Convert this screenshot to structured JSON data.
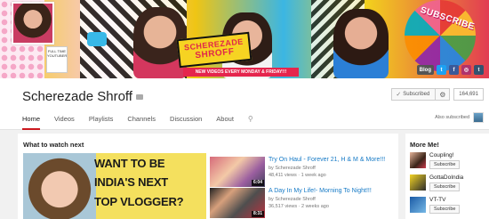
{
  "banner": {
    "logo_line1": "SCHEREZADE",
    "logo_line2": "SHROFF",
    "tagline": "NEW VIDEOS EVERY MONDAY & FRIDAY!!!",
    "subscribe_art": "SUBSCRIBE",
    "phone_card_text": "FULL TIME YOUTUBER",
    "links": [
      {
        "label": "Blog",
        "icon": "blog-icon",
        "color": "#555555"
      },
      {
        "label": "t",
        "icon": "twitter-icon",
        "color": "#1da1f2"
      },
      {
        "label": "f",
        "icon": "facebook-icon",
        "color": "#3b5998"
      },
      {
        "label": "◎",
        "icon": "instagram-icon",
        "color": "#b0326d"
      },
      {
        "label": "t",
        "icon": "tumblr-icon",
        "color": "#34526f"
      }
    ]
  },
  "channel": {
    "title": "Scherezade Shroff",
    "subscribe_label": "Subscribed",
    "subscriber_count": "164,691"
  },
  "tabs": [
    {
      "label": "Home",
      "active": true
    },
    {
      "label": "Videos"
    },
    {
      "label": "Playlists"
    },
    {
      "label": "Channels"
    },
    {
      "label": "Discussion"
    },
    {
      "label": "About"
    }
  ],
  "also_subscribed_label": "Also subscribed",
  "main": {
    "section_title": "What to watch next",
    "feature_text": [
      "WANT TO BE",
      "INDIA'S NEXT",
      "TOP VLOGGER?"
    ],
    "videos": [
      {
        "title": "Try On Haul - Forever 21, H & M & More!!!",
        "by": "by Scherezade Shroff",
        "meta": "48,411 views · 1 week ago",
        "duration": "6:04"
      },
      {
        "title": "A Day In My Life!- Morning To Night!!!",
        "by": "by Scherezade Shroff",
        "meta": "36,517 views · 2 weeks ago",
        "duration": "8:31"
      }
    ]
  },
  "sidebar": {
    "title": "More Me!",
    "items": [
      {
        "name": "Coupling!",
        "button": "Subscribe"
      },
      {
        "name": "GottaDoIndia",
        "button": "Subscribe"
      },
      {
        "name": "VT-TV",
        "button": "Subscribe"
      }
    ]
  },
  "colors": {
    "accent": "#cc181e",
    "link": "#167ac6",
    "brand_pink": "#e0264a",
    "banner_yellow": "#f4d21f"
  }
}
